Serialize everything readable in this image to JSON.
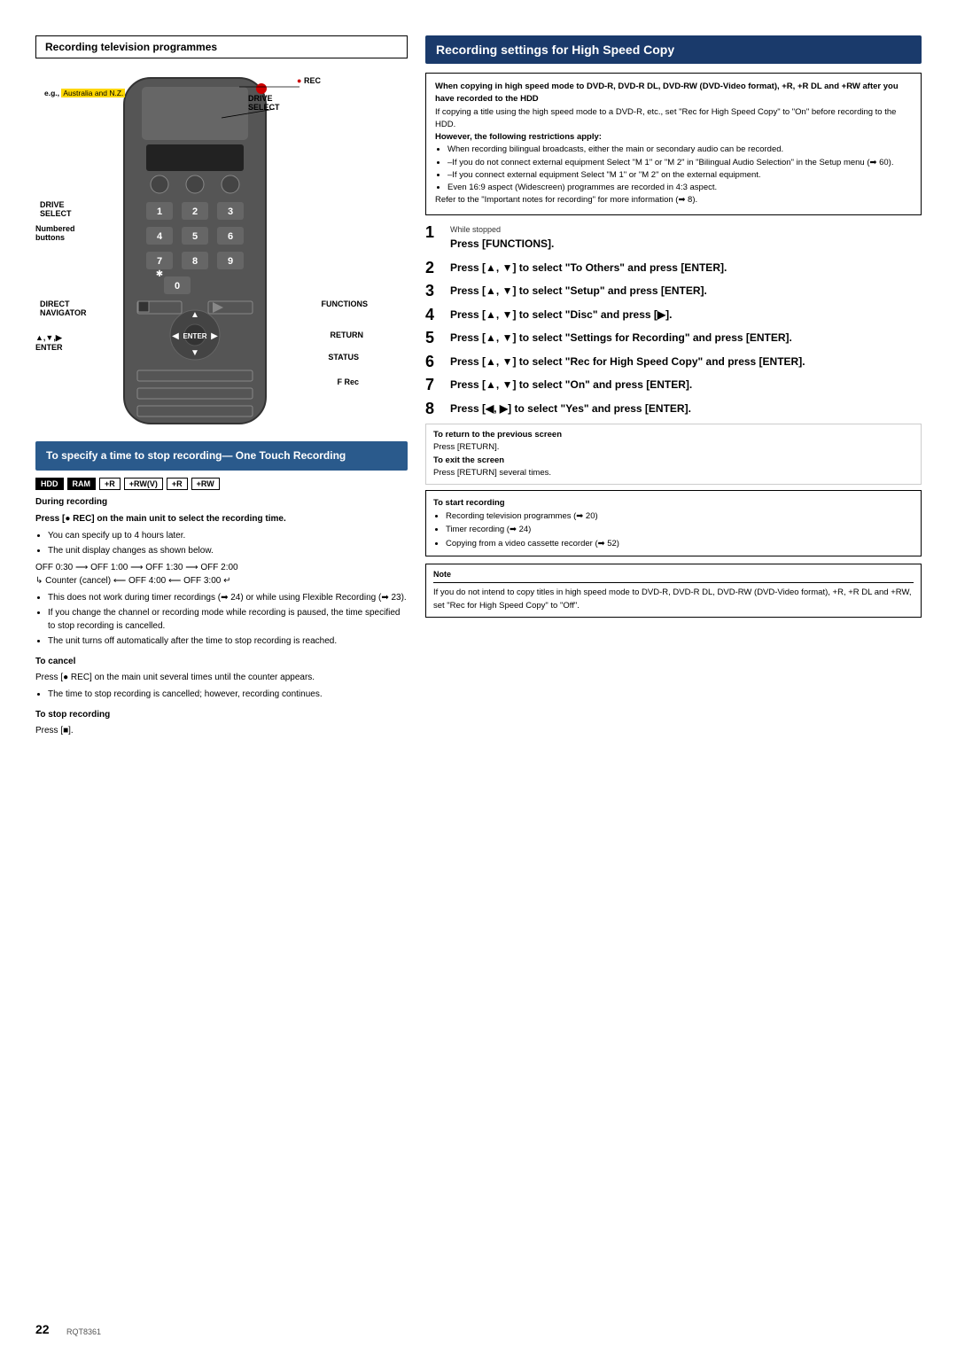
{
  "page": {
    "number": "22",
    "doc_code": "RQT8361"
  },
  "left_section": {
    "header": "Recording television programmes",
    "remote": {
      "labels": {
        "drive_select_top": "DRIVE\nSELECT",
        "rec": "● REC",
        "eg": "e.g., Australia and N.Z.",
        "drive_select": "DRIVE\nSELECT",
        "numbered": "Numbered\nbuttons",
        "direct_navigator": "DIRECT\nNAVIGATOR",
        "arrows_enter": "▲,▼,▶\nENTER",
        "functions": "FUNCTIONS",
        "return": "RETURN",
        "status": "STATUS",
        "f_rec": "F Rec"
      }
    },
    "ot_box": {
      "title": "To specify a time to stop recording—\nOne Touch Recording",
      "badges": [
        "HDD",
        "RAM",
        "+R",
        "+RW(V)",
        "+R",
        "+RW"
      ],
      "during_recording": "During recording",
      "instruction": "Press [● REC] on the main unit to select the recording time.",
      "bullets": [
        "You can specify up to 4 hours later.",
        "The unit display changes as shown below."
      ],
      "timer_line1": "OFF 0:30 ⟶ OFF 1:00 ⟶ OFF 1:30 ⟶ OFF 2:00",
      "timer_line2": "↳ Counter (cancel) ⟵ OFF 4:00 ⟵ OFF 3:00 ↵",
      "bullets2": [
        "This does not work during timer recordings (➡ 24) or while using Flexible Recording (➡ 23).",
        "If you change the channel or recording mode while recording is paused, the time specified to stop recording is cancelled.",
        "The unit turns off automatically after the time to stop recording is reached."
      ],
      "to_cancel_header": "To cancel",
      "to_cancel_text": "Press [● REC] on the main unit several times until the counter appears.",
      "to_cancel_bullets": [
        "The time to stop recording is cancelled; however, recording continues."
      ],
      "to_stop_header": "To stop recording",
      "to_stop_text": "Press [■]."
    }
  },
  "right_section": {
    "hsc_title": "Recording settings for High Speed Copy",
    "warning": {
      "bold_text": "When copying in high speed mode to DVD-R, DVD-R DL, DVD-RW (DVD-Video format), +R, +R DL and +RW after you have recorded to the HDD",
      "text1": "If copying a title using the high speed mode to a DVD-R, etc., set \"Rec for High Speed Copy\" to \"On\" before recording to the HDD.",
      "restrictions_header": "However, the following restrictions apply:",
      "bullets": [
        "When recording bilingual broadcasts, either the main or secondary audio can be recorded.",
        "–If you do not connect external equipment\nSelect \"M 1\" or \"M 2\" in \"Bilingual Audio Selection\" in the Setup menu (➡ 60).",
        "–If you connect external equipment\nSelect \"M 1\" or \"M 2\" on the external equipment.",
        "Even 16:9 aspect (Widescreen) programmes are recorded in 4:3 aspect."
      ],
      "refer": "Refer to the \"Important notes for recording\" for more information (➡ 8)."
    },
    "steps": [
      {
        "num": "1",
        "subtitle": "While stopped",
        "main": "Press [FUNCTIONS]."
      },
      {
        "num": "2",
        "main": "Press [▲, ▼] to select \"To Others\" and press [ENTER]."
      },
      {
        "num": "3",
        "main": "Press [▲, ▼] to select \"Setup\" and press [ENTER]."
      },
      {
        "num": "4",
        "main": "Press [▲, ▼] to select \"Disc\" and press [▶]."
      },
      {
        "num": "5",
        "main": "Press [▲, ▼] to select \"Settings for Recording\" and press [ENTER]."
      },
      {
        "num": "6",
        "main": "Press [▲, ▼] to select \"Rec for High Speed Copy\" and press [ENTER]."
      },
      {
        "num": "7",
        "main": "Press [▲, ▼] to select \"On\" and press [ENTER]."
      },
      {
        "num": "8",
        "main": "Press [◀, ▶] to select \"Yes\" and press [ENTER]."
      }
    ],
    "return_box": {
      "return_header": "To return to the previous screen",
      "return_text": "Press [RETURN].",
      "exit_header": "To exit the screen",
      "exit_text": "Press [RETURN] several times."
    },
    "start_rec": {
      "header": "To start recording",
      "bullets": [
        "Recording television programmes (➡ 20)",
        "Timer recording (➡ 24)",
        "Copying from a video cassette recorder (➡ 52)"
      ]
    },
    "note": {
      "header": "Note",
      "text": "If you do not intend to copy titles in high speed mode to DVD-R, DVD-R DL, DVD-RW (DVD-Video format), +R, +R DL and +RW, set \"Rec for High Speed Copy\" to \"Off\"."
    }
  }
}
